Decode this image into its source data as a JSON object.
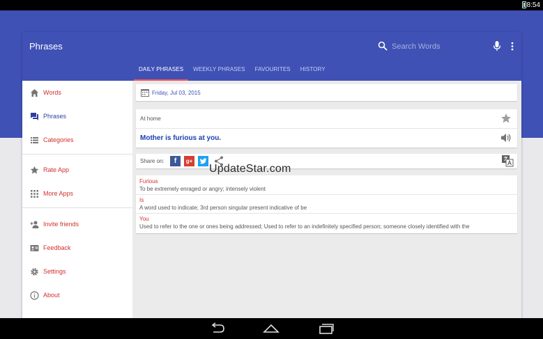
{
  "status_bar": {
    "time": "8:54"
  },
  "app": {
    "title": "Phrases",
    "search_placeholder": "Search Words"
  },
  "tabs": [
    {
      "label": "DAILY PHRASES",
      "active": true
    },
    {
      "label": "WEEKLY PHRASES",
      "active": false
    },
    {
      "label": "FAVOURITES",
      "active": false
    },
    {
      "label": "HISTORY",
      "active": false
    }
  ],
  "sidebar": {
    "items": [
      {
        "label": "Words",
        "icon": "home-icon"
      },
      {
        "label": "Phrases",
        "icon": "chat-icon",
        "selected": true
      },
      {
        "label": "Categories",
        "icon": "list-icon"
      },
      {
        "label": "Rate App",
        "icon": "star-icon"
      },
      {
        "label": "More Apps",
        "icon": "grid-icon"
      },
      {
        "label": "Invite friends",
        "icon": "person-add-icon"
      },
      {
        "label": "Feedback",
        "icon": "contact-card-icon"
      },
      {
        "label": "Settings",
        "icon": "gear-icon"
      },
      {
        "label": "About",
        "icon": "info-icon"
      }
    ]
  },
  "daily": {
    "date": "Friday, Jul 03, 2015",
    "context": "At home",
    "phrase": "Mother is furious at you.",
    "share_label": "Share on:"
  },
  "watermark": "UpdateStar.com",
  "words": [
    {
      "word": "Furious",
      "definition": "To be extremely enraged or angry; intensely violent"
    },
    {
      "word": "Is",
      "definition": "A word used to indicate; 3rd person singular present indicative of be"
    },
    {
      "word": "You",
      "definition": "Used to refer to the one or ones being addressed; Used to refer to an indefinitely specified person; someone closely identified with the"
    }
  ],
  "colors": {
    "primary": "#3f51b5",
    "accent": "#d32f2f",
    "tab_indicator": "#ff5252",
    "phrase_text": "#1a3eb0"
  }
}
